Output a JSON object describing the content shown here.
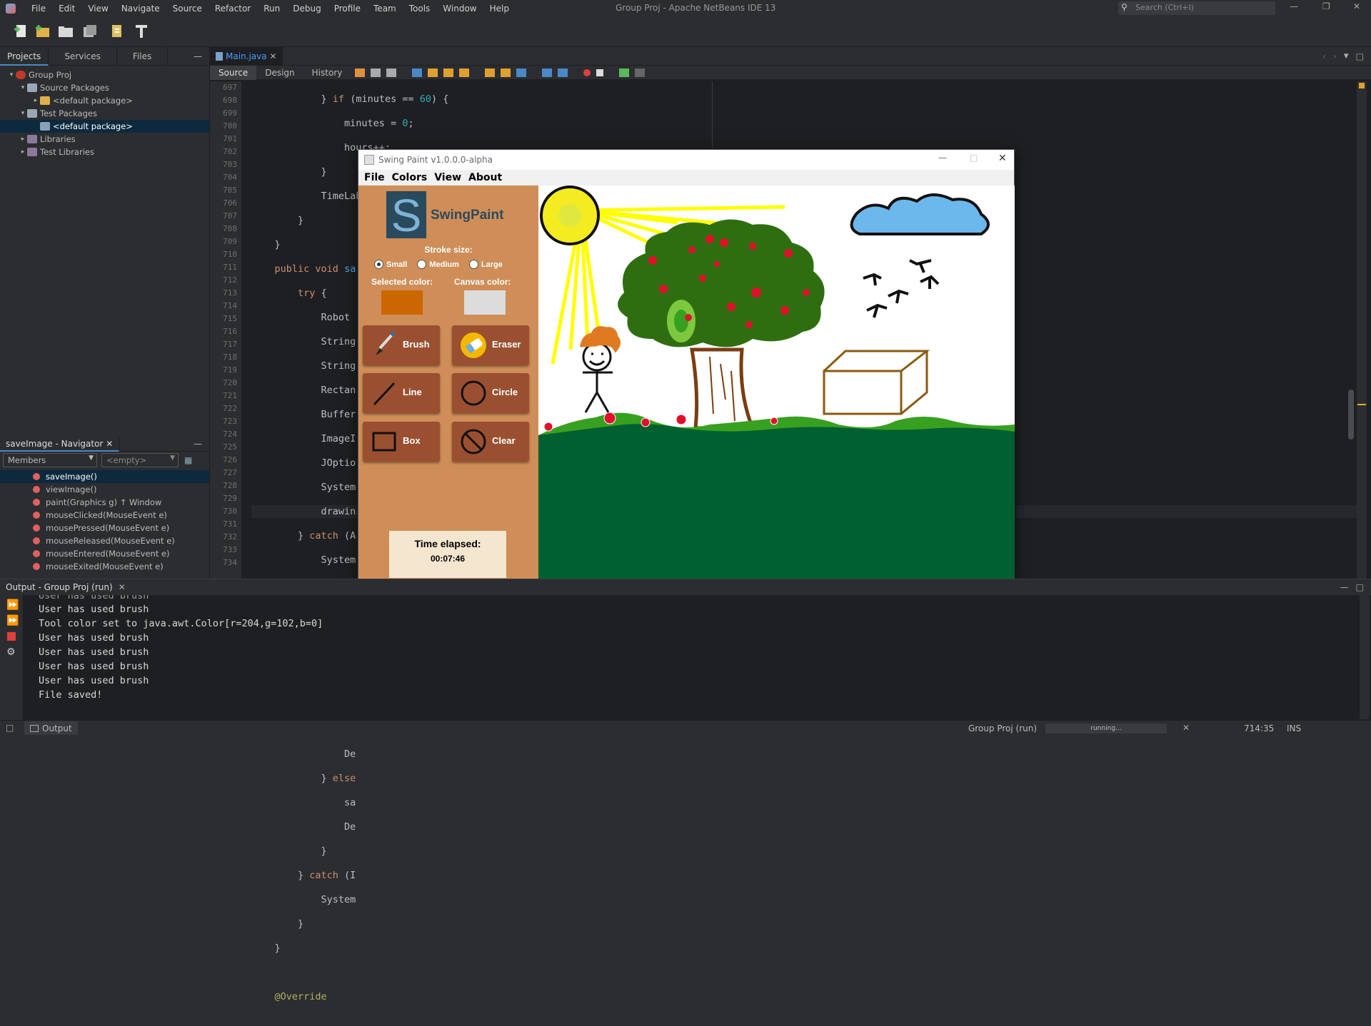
{
  "app": {
    "window_title": "Group Proj - Apache NetBeans IDE 13",
    "menu": [
      "File",
      "Edit",
      "View",
      "Navigate",
      "Source",
      "Refactor",
      "Run",
      "Debug",
      "Profile",
      "Team",
      "Tools",
      "Window",
      "Help"
    ],
    "search_placeholder": "Search (Ctrl+I)"
  },
  "projects_panel": {
    "tabs": [
      "Projects",
      "Services",
      "Files"
    ],
    "tree": [
      {
        "label": "Group Proj",
        "level": 0
      },
      {
        "label": "Source Packages",
        "level": 1
      },
      {
        "label": "<default package>",
        "level": 2
      },
      {
        "label": "Test Packages",
        "level": 1
      },
      {
        "label": "<default package>",
        "level": 2
      },
      {
        "label": "Libraries",
        "level": 1
      },
      {
        "label": "Test Libraries",
        "level": 1
      }
    ]
  },
  "navigator": {
    "title": "saveImage - Navigator",
    "members_label": "Members",
    "empty_label": "<empty>",
    "items": [
      "saveImage()",
      "viewImage()",
      "paint(Graphics g) ↑ Window",
      "mouseClicked(MouseEvent e)",
      "mousePressed(MouseEvent e)",
      "mouseReleased(MouseEvent e)",
      "mouseEntered(MouseEvent e)",
      "mouseExited(MouseEvent e)"
    ]
  },
  "editor": {
    "tab": "Main.java",
    "view_tabs": [
      "Source",
      "Design",
      "History"
    ],
    "line_numbers": [
      "697",
      "698",
      "699",
      "700",
      "701",
      "702",
      "703",
      "704",
      "705",
      "706",
      "707",
      "708",
      "709",
      "710",
      "711",
      "712",
      "713",
      "714",
      "715",
      "716",
      "717",
      "718",
      "719",
      "720",
      "721",
      "722",
      "723",
      "724",
      "725",
      "726",
      "727",
      "728",
      "729",
      "730",
      "731",
      "732",
      "733",
      "734"
    ]
  },
  "swing_paint": {
    "title": "Swing Paint v1.0.0.0-alpha",
    "menu": [
      "File",
      "Colors",
      "View",
      "About"
    ],
    "logo_text": "SwingPaint",
    "stroke_label": "Stroke size:",
    "stroke_options": [
      "Small",
      "Medium",
      "Large"
    ],
    "selected_color_label": "Selected color:",
    "canvas_color_label": "Canvas color:",
    "selected_color": "#cc6600",
    "canvas_color": "#dcdcdc",
    "tools": [
      "Brush",
      "Eraser",
      "Line",
      "Circle",
      "Box",
      "Clear"
    ],
    "time_label": "Time elapsed:",
    "time_value": "00:07:46"
  },
  "output": {
    "title": "Output - Group Proj (run)",
    "lines": [
      "User has used brush",
      "Tool color set to java.awt.Color[r=204,g=102,b=0]",
      "User has used brush",
      "User has used brush",
      "User has used brush",
      "User has used brush",
      "File saved!"
    ],
    "partial_top_line": "User has used brush"
  },
  "status": {
    "output_tab": "Output",
    "run_label": "Group Proj (run)",
    "progress_text": "running...",
    "position": "714:35",
    "mode": "INS"
  }
}
